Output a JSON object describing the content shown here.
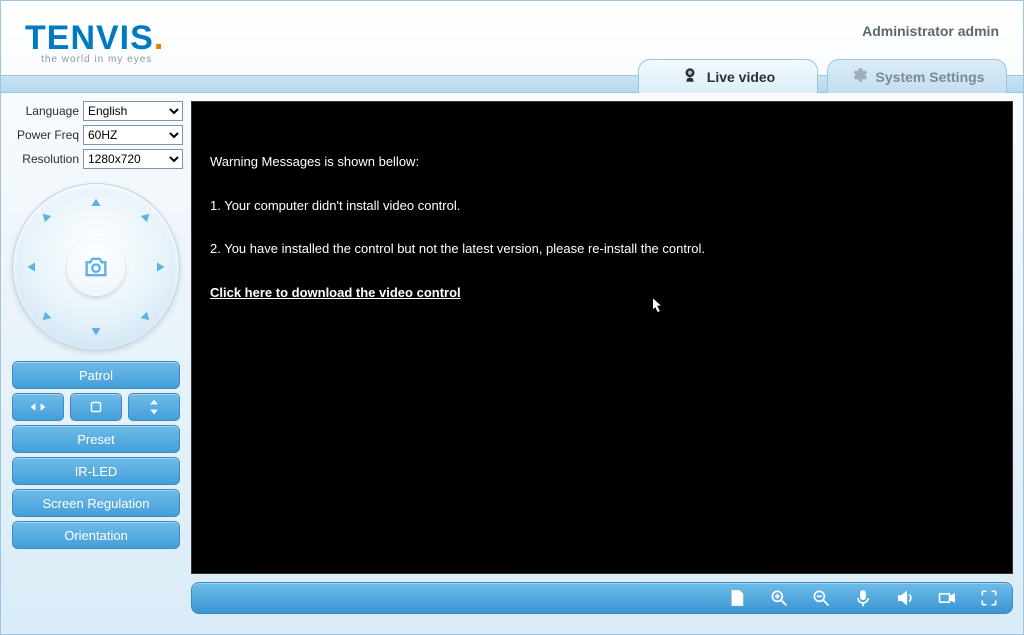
{
  "header": {
    "brand": "TENVIS",
    "tagline": "the world in my eyes",
    "admin_text": "Administrator admin"
  },
  "tabs": {
    "live": "Live video",
    "settings": "System Settings"
  },
  "sidebar": {
    "language_label": "Language",
    "language_value": "English",
    "freq_label": "Power Freq",
    "freq_value": "60HZ",
    "resolution_label": "Resolution",
    "resolution_value": "1280x720",
    "patrol": "Patrol",
    "preset": "Preset",
    "irled": "IR-LED",
    "screen_reg": "Screen Regulation",
    "orientation": "Orientation"
  },
  "video": {
    "warn_header": "Warning Messages is shown bellow:",
    "warn_1": "1. Your computer didn't install video control.",
    "warn_2": "2. You have installed the control but not the latest version, please re-install the control.",
    "download_link": "Click here to download the video control"
  }
}
